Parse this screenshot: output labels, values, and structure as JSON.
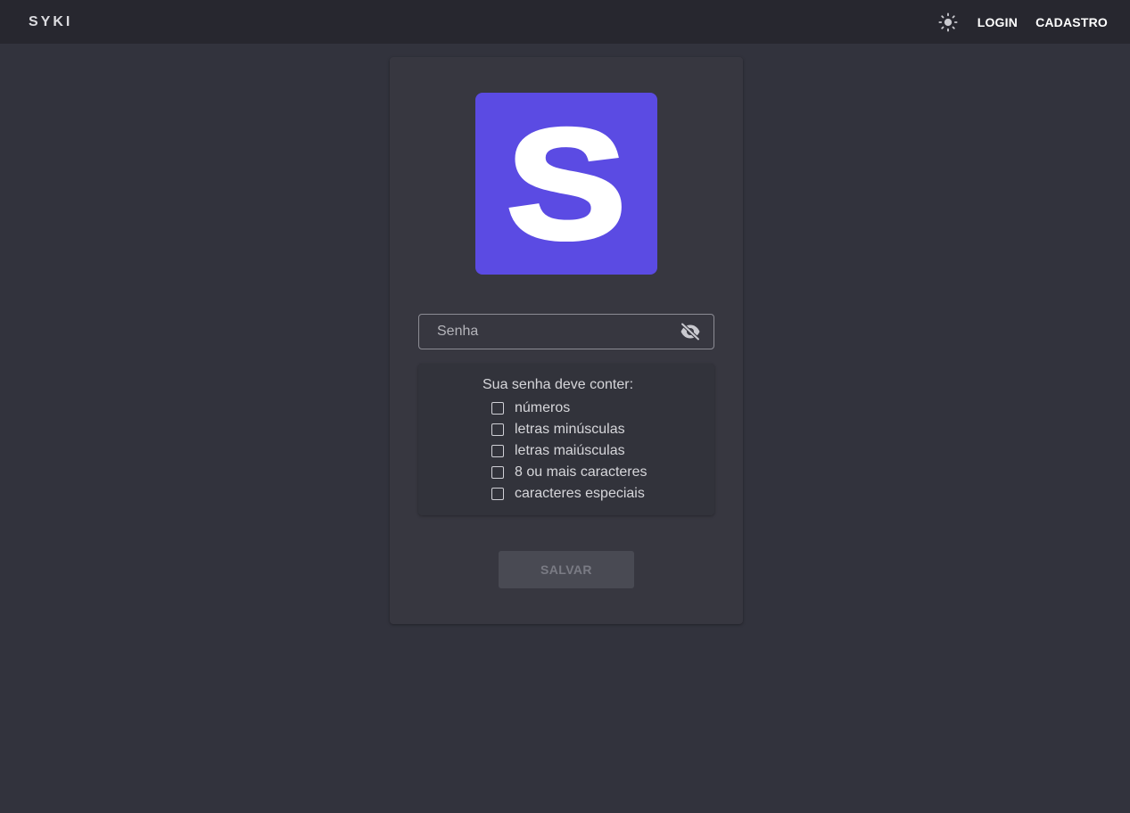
{
  "appbar": {
    "brand": "SYKI",
    "theme_icon": "sun-icon",
    "login_label": "LOGIN",
    "signup_label": "CADASTRO"
  },
  "card": {
    "logo_icon": "syki-logo",
    "logo_letter": "S",
    "password": {
      "placeholder": "Senha",
      "value": "",
      "visibility_icon": "eye-off-icon"
    },
    "requirements": {
      "title": "Sua senha deve conter:",
      "items": [
        {
          "label": "números",
          "checked": false
        },
        {
          "label": "letras minúsculas",
          "checked": false
        },
        {
          "label": "letras maiúsculas",
          "checked": false
        },
        {
          "label": "8 ou mais caracteres",
          "checked": false
        },
        {
          "label": "caracteres especiais",
          "checked": false
        }
      ]
    },
    "save_label": "SALVAR",
    "save_disabled": true
  },
  "colors": {
    "background": "#32333d",
    "appbar": "#27272f",
    "card": "#373740",
    "brand_accent": "#5b4be3"
  }
}
